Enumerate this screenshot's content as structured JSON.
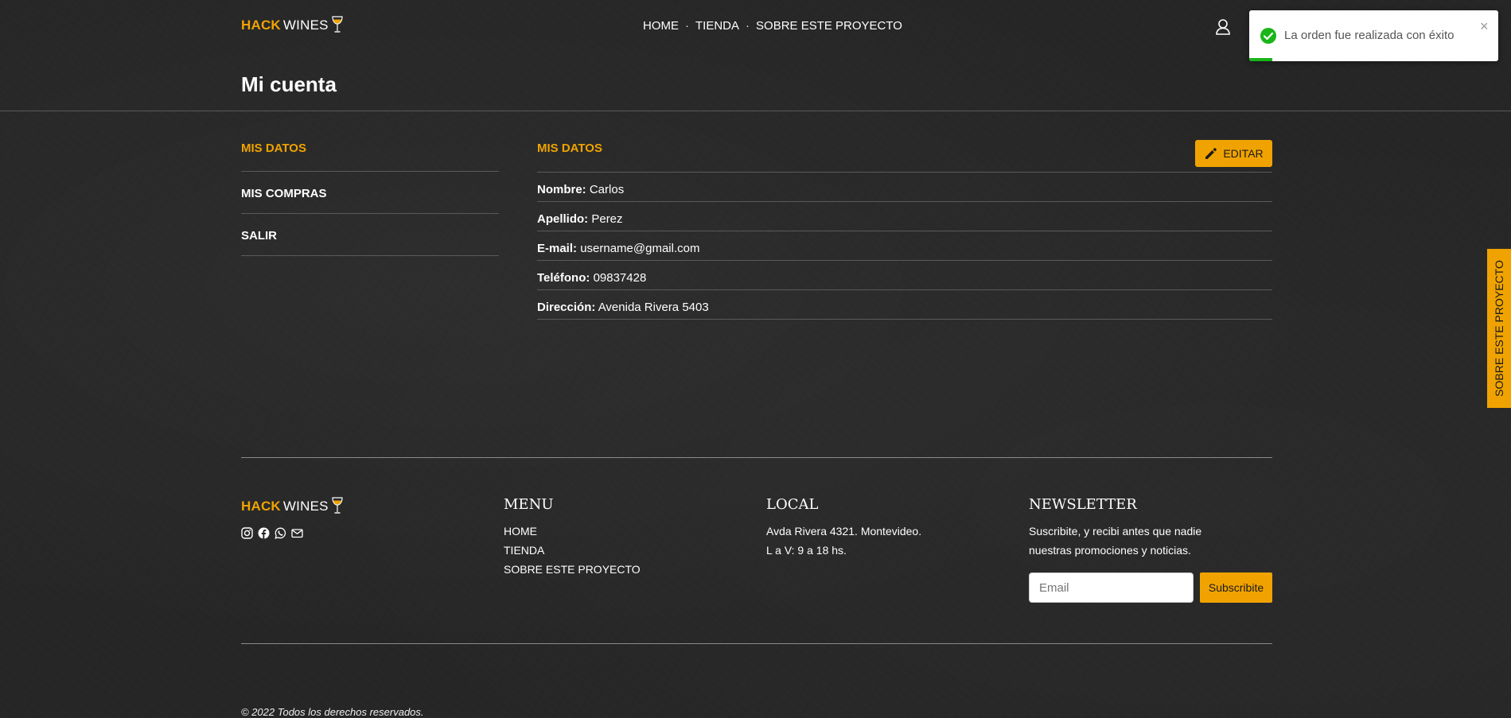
{
  "header": {
    "logo": {
      "hack": "HACK",
      "wines": "WINES"
    },
    "nav": [
      "HOME",
      "TIENDA",
      "SOBRE ESTE PROYECTO"
    ],
    "nav_separator": "·",
    "user_icon": "user-icon"
  },
  "page": {
    "title": "Mi cuenta"
  },
  "sidebar": {
    "items": [
      "MIS DATOS",
      "MIS COMPRAS",
      "SALIR"
    ]
  },
  "profile": {
    "heading": "MIS DATOS",
    "edit_label": "EDITAR",
    "fields": [
      {
        "label": "Nombre:",
        "value": "Carlos"
      },
      {
        "label": "Apellido:",
        "value": "Perez"
      },
      {
        "label": "E-mail:",
        "value": "username@gmail.com"
      },
      {
        "label": "Teléfono:",
        "value": "09837428"
      },
      {
        "label": "Dirección:",
        "value": "Avenida Rivera 5403"
      }
    ]
  },
  "toast": {
    "message": "La orden fue realizada con éxito",
    "close": "×",
    "icon": "check-circle-icon"
  },
  "side_tab": {
    "label": "SOBRE ESTE PROYECTO"
  },
  "footer": {
    "logo": {
      "hack": "HACK",
      "wines": "WINES"
    },
    "social_icons": [
      "instagram-icon",
      "facebook-icon",
      "whatsapp-icon",
      "mail-icon"
    ],
    "menu": {
      "heading": "MENU",
      "items": [
        "HOME",
        "TIENDA",
        "SOBRE ESTE PROYECTO"
      ]
    },
    "local": {
      "heading": "LOCAL",
      "lines": [
        "Avda Rivera 4321. Montevideo.",
        "L a V: 9 a 18 hs."
      ]
    },
    "newsletter": {
      "heading": "NEWSLETTER",
      "lines": [
        "Suscribite, y recibi antes que nadie",
        "nuestras promociones y noticias."
      ],
      "placeholder": "Email",
      "button": "Subscribite"
    },
    "copyright": "© 2022 Todos los derechos reservados."
  },
  "colors": {
    "accent": "#f0a300",
    "success": "#19b519",
    "background": "#262626"
  }
}
